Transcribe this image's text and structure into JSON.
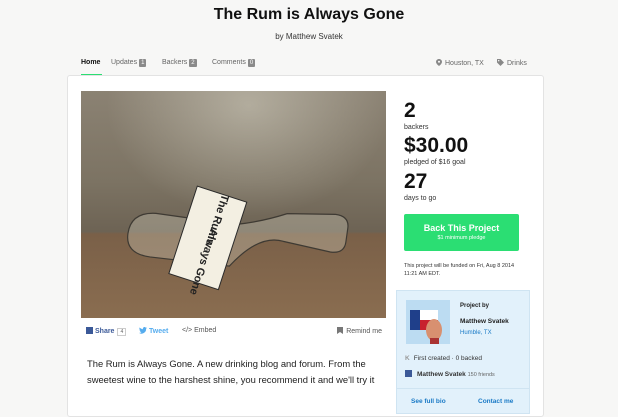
{
  "project": {
    "title": "The Rum is Always Gone",
    "byline": "by Matthew Svatek"
  },
  "nav": {
    "tabs": [
      {
        "label": "Home",
        "count": ""
      },
      {
        "label": "Updates",
        "count": "1"
      },
      {
        "label": "Backers",
        "count": "2"
      },
      {
        "label": "Comments",
        "count": "0"
      }
    ],
    "location": "Houston, TX",
    "category": "Drinks"
  },
  "video": {
    "label_lines": [
      "The Rum",
      "is",
      "Always Gone"
    ]
  },
  "stats": {
    "backers_count": "2",
    "backers_label": "backers",
    "pledged_amount": "$30.00",
    "pledged_label": "pledged of $16 goal",
    "days_count": "27",
    "days_label": "days to go"
  },
  "cta": {
    "label": "Back This Project",
    "sub_label": "$1 minimum pledge",
    "funding_note": "This project will be funded on Fri, Aug 8 2014 11:21 AM EDT."
  },
  "share": {
    "share_label": "Share",
    "share_count": "4",
    "tweet_label": "Tweet",
    "embed_label": "Embed",
    "remind_label": "Remind me"
  },
  "blurb": "The Rum is Always Gone. A new drinking blog and forum. From the sweetest wine to the harshest shine, you recommend it and we'll try it",
  "creator": {
    "heading": "Project by",
    "name": "Matthew Svatek",
    "location": "Humble, TX",
    "first_created": "First created · 0 backed",
    "fb_name": "Matthew Svatek",
    "fb_friends": "150 friends",
    "bio_link": "See full bio",
    "contact_link": "Contact me"
  },
  "colors": {
    "accent": "#2bde73",
    "link": "#1a7ac6",
    "creator_bg": "#e2f1fb",
    "facebook": "#3b5998"
  }
}
